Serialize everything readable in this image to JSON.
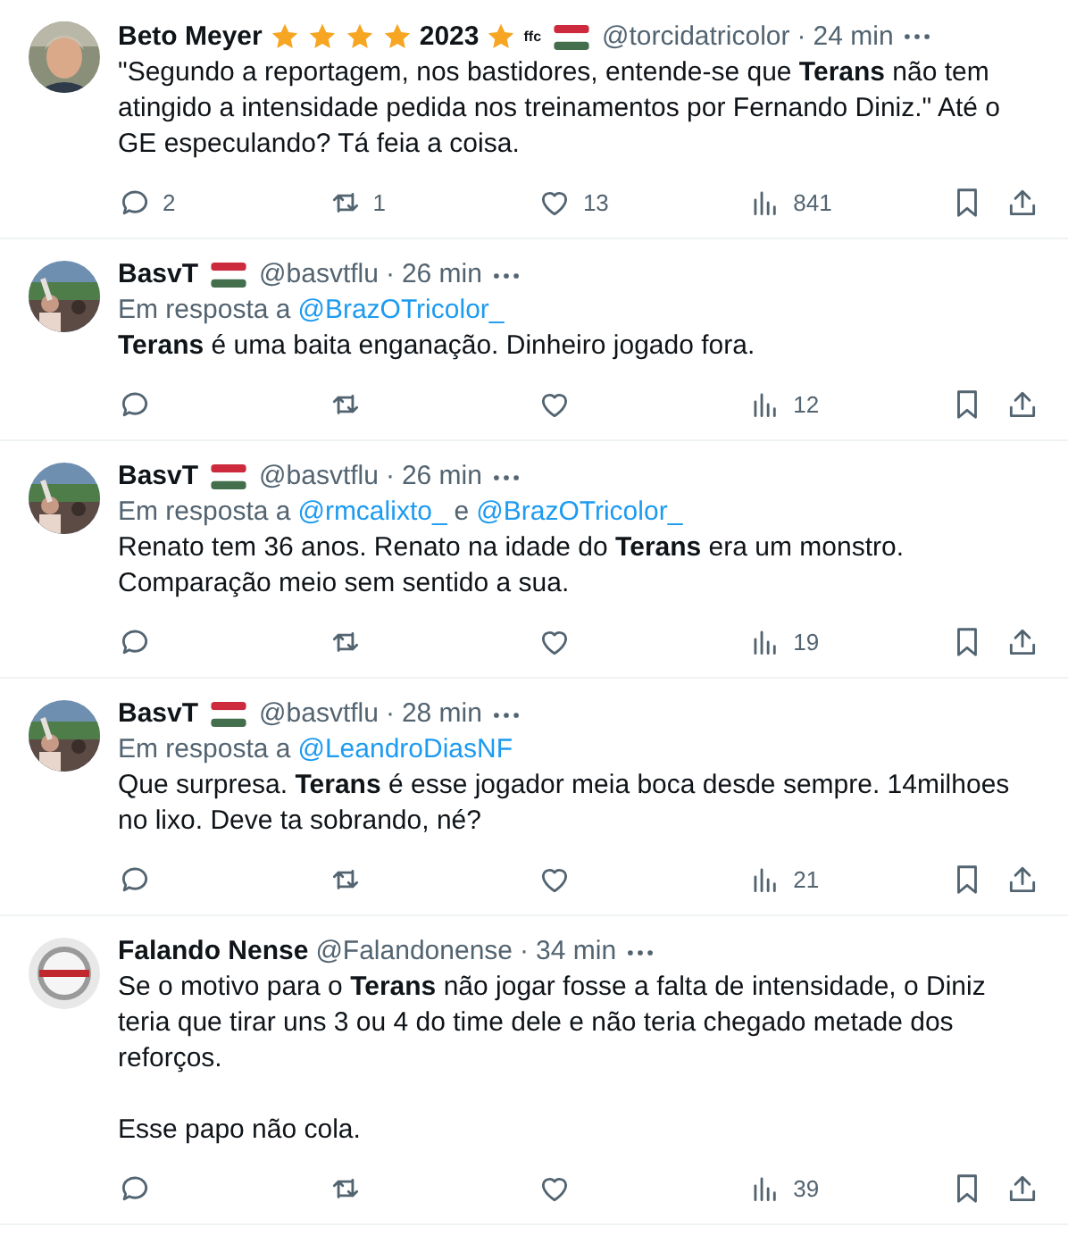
{
  "tweets": [
    {
      "name": [
        {
          "kind": "text",
          "text": "Beto Meyer"
        },
        {
          "kind": "star"
        },
        {
          "kind": "star"
        },
        {
          "kind": "star"
        },
        {
          "kind": "star"
        },
        {
          "kind": "text",
          "text": "2023"
        },
        {
          "kind": "star"
        },
        {
          "kind": "sup",
          "text": "ffc"
        },
        {
          "kind": "flag"
        }
      ],
      "handle": "@torcidatricolor",
      "separator": "·",
      "time": "24 min",
      "paragraphs": [
        "\"Segundo a reportagem, nos bastidores, entende-se que **Terans** não tem atingido a intensidade pedida nos treinamentos por Fernando Diniz.\" Até o GE especulando? Tá feia a coisa."
      ],
      "replies": "2",
      "reposts": "1",
      "likes": "13",
      "views": "841"
    },
    {
      "name": [
        {
          "kind": "text",
          "text": "BasvT"
        },
        {
          "kind": "flag"
        }
      ],
      "handle": "@basvtflu",
      "separator": "·",
      "time": "26 min",
      "reply_to": {
        "prefix": "Em resposta a",
        "mentions": [
          "@BrazOTricolor_"
        ]
      },
      "paragraphs": [
        "**Terans** é uma baita enganação. Dinheiro jogado fora."
      ],
      "views": "12"
    },
    {
      "name": [
        {
          "kind": "text",
          "text": "BasvT"
        },
        {
          "kind": "flag"
        }
      ],
      "handle": "@basvtflu",
      "separator": "·",
      "time": "26 min",
      "reply_to": {
        "prefix": "Em resposta a",
        "mentions": [
          "@rmcalixto_",
          "@BrazOTricolor_"
        ],
        "joiner": "e"
      },
      "paragraphs": [
        "Renato tem 36 anos. Renato na idade do **Terans** era um monstro. Comparação meio sem sentido a sua."
      ],
      "views": "19"
    },
    {
      "name": [
        {
          "kind": "text",
          "text": "BasvT"
        },
        {
          "kind": "flag"
        }
      ],
      "handle": "@basvtflu",
      "separator": "·",
      "time": "28 min",
      "reply_to": {
        "prefix": "Em resposta a",
        "mentions": [
          "@LeandroDiasNF"
        ]
      },
      "paragraphs": [
        "Que surpresa. **Terans** é esse jogador meia boca desde sempre. 14milhoes no lixo. Deve ta sobrando, né?"
      ],
      "views": "21"
    },
    {
      "name": [
        {
          "kind": "text",
          "text": "Falando Nense"
        }
      ],
      "handle": "@Falandonense",
      "separator": "·",
      "time": "34 min",
      "paragraphs": [
        "Se o motivo para o **Terans** não jogar fosse a falta de intensidade, o Diniz teria que tirar uns 3 ou 4 do time dele e não teria chegado metade dos reforços.",
        "Esse papo não cola."
      ],
      "views": "39"
    }
  ]
}
